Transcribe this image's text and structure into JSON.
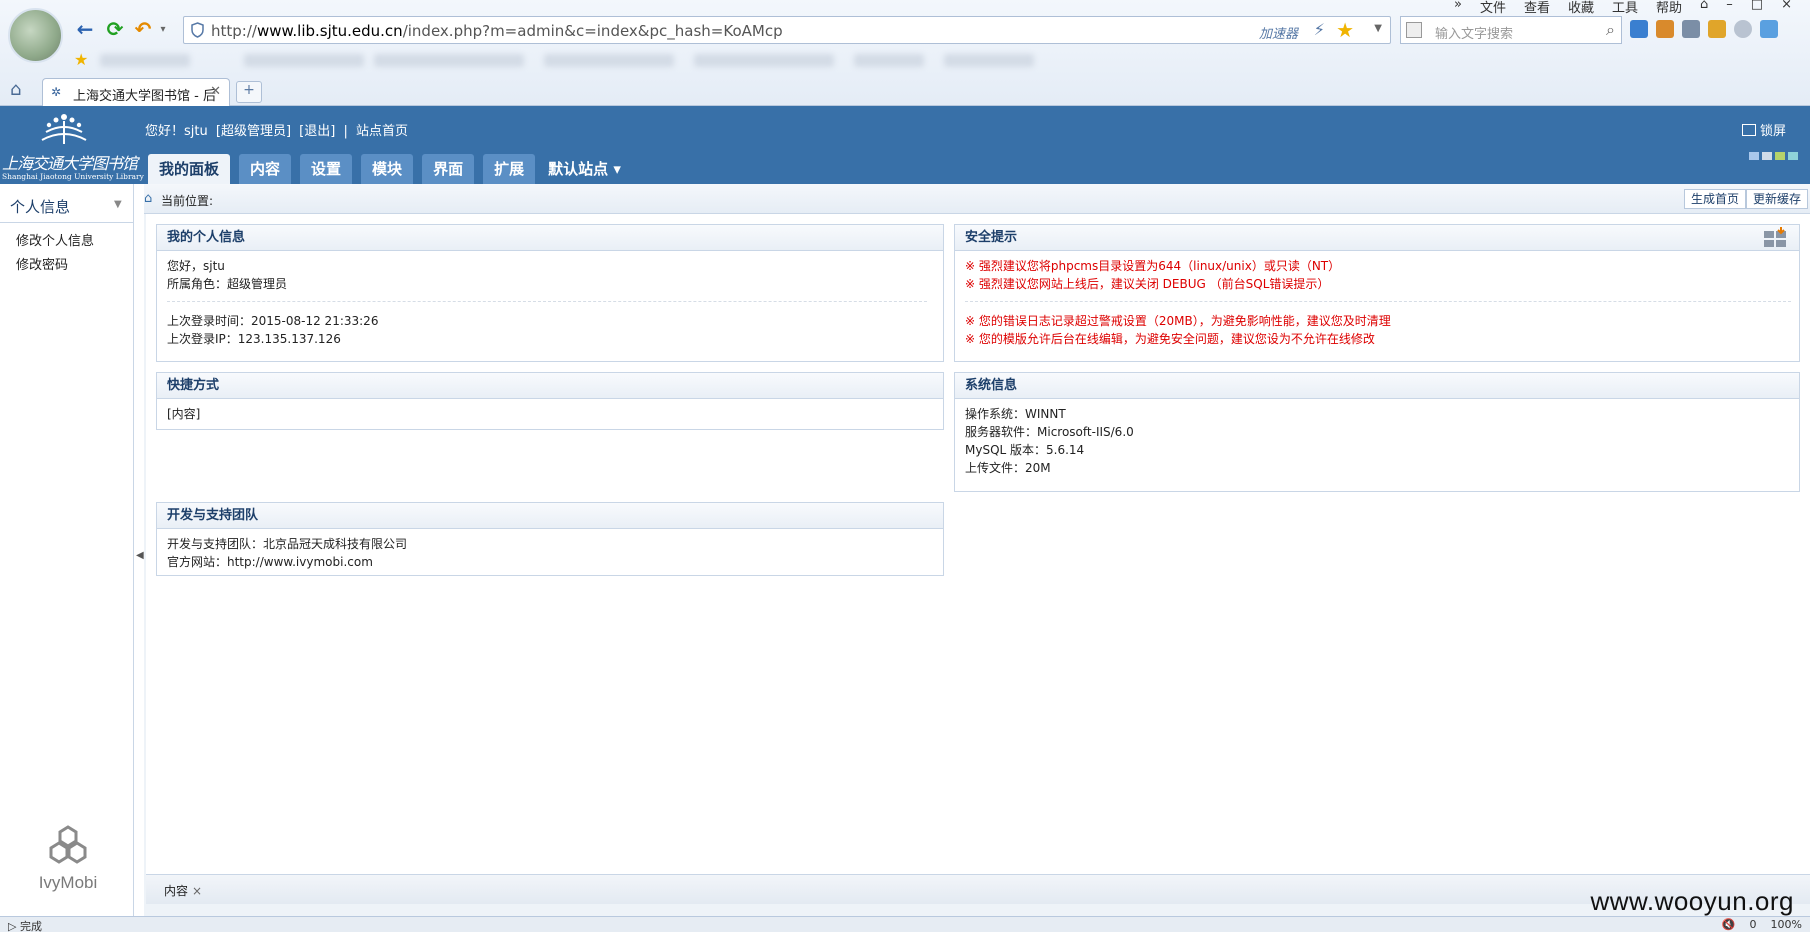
{
  "browser": {
    "url_prefix": "http://",
    "url_domain": "www.lib.sjtu.edu.cn",
    "url_path": "/index.php?m=admin&c=index&pc_hash=KoAMcp",
    "accelerator_label": "加速器",
    "search_placeholder": "输入文字搜索",
    "menu": [
      "»",
      "文件",
      "查看",
      "收藏",
      "工具",
      "帮助"
    ],
    "tab_title": "上海交通大学图书馆 - 后",
    "new_tab": "+",
    "status_left": "完成",
    "status_right": [
      "🔇",
      "0",
      "100%"
    ],
    "accent_color": "#3870a8"
  },
  "header": {
    "logo_cn": "上海交通大学图书馆",
    "logo_en": "Shanghai Jiaotong University Library",
    "greeting": "您好！sjtu",
    "role_link": "[超级管理员]",
    "logout_link": "[退出]",
    "site_home_link": "站点首页",
    "nav_tabs": [
      "我的面板",
      "内容",
      "设置",
      "模块",
      "界面",
      "扩展"
    ],
    "site_selector": "默认站点",
    "lock_label": "锁屏"
  },
  "sidebar": {
    "title": "个人信息",
    "items": [
      "修改个人信息",
      "修改密码"
    ],
    "brand": "IvyMobi"
  },
  "main": {
    "breadcrumb_label": "当前位置:",
    "generate_home_button": "生成首页",
    "update_cache_button": "更新缓存",
    "panels": {
      "personal": {
        "title": "我的个人信息",
        "hello": "您好，sjtu",
        "role": "所属角色：超级管理员",
        "last_login_time": "上次登录时间：2015-08-12 21:33:26",
        "last_login_ip": "上次登录IP：123.135.137.126"
      },
      "security": {
        "title": "安全提示",
        "tips": [
          "※ 强烈建议您将phpcms目录设置为644（linux/unix）或只读（NT）",
          "※ 强烈建议您网站上线后，建议关闭 DEBUG （前台SQL错误提示）",
          "※ 您的错误日志记录超过警戒设置（20MB），为避免影响性能，建议您及时清理",
          "※ 您的模版允许后台在线编辑，为避免安全问题，建议您设为不允许在线修改"
        ]
      },
      "shortcuts": {
        "title": "快捷方式",
        "item": "[内容]"
      },
      "sysinfo": {
        "title": "系统信息",
        "os": "操作系统：WINNT",
        "server": "服务器软件：Microsoft-IIS/6.0",
        "mysql": "MySQL 版本：5.6.14",
        "upload": "上传文件：20M"
      },
      "team": {
        "title": "开发与支持团队",
        "team": "开发与支持团队：北京品冠天成科技有限公司",
        "site": "官方网站：http://www.ivymobi.com"
      }
    },
    "bottom_tab": "内容",
    "bottom_tab_close": "×"
  },
  "watermark": "www.wooyun.org"
}
